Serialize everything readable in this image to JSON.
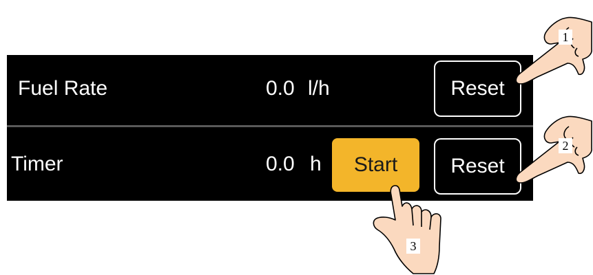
{
  "rows": [
    {
      "label": "Fuel Rate",
      "value": "0.0",
      "unit": "l/h",
      "reset_label": "Reset"
    },
    {
      "label": "Timer",
      "value": "0.0",
      "unit": "h",
      "start_label": "Start",
      "reset_label": "Reset"
    }
  ],
  "callouts": [
    "1",
    "2",
    "3"
  ],
  "colors": {
    "panel_bg": "#000000",
    "text": "#ffffff",
    "start_button": "#f3b52a",
    "divider": "#5a5a5a"
  },
  "icons": [
    "pointing-hand-icon"
  ]
}
